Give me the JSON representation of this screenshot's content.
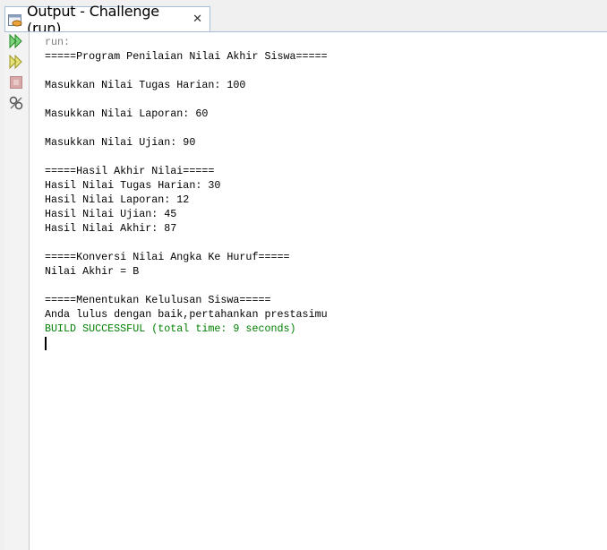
{
  "tab": {
    "title": "Output - Challenge (run)",
    "close": "✕",
    "icon": "output-window-icon"
  },
  "toolbar": [
    {
      "name": "rerun-icon",
      "color": "#2e9b2e"
    },
    {
      "name": "rerun-with-options-icon",
      "color": "#b5b52a"
    },
    {
      "name": "stop-icon",
      "color": "#c99"
    },
    {
      "name": "settings-icon",
      "color": "#777"
    }
  ],
  "output": {
    "lines": [
      {
        "text": "run:",
        "style": "gray"
      },
      {
        "text": "=====Program Penilaian Nilai Akhir Siswa=====",
        "style": ""
      },
      {
        "text": "",
        "style": ""
      },
      {
        "text": "Masukkan Nilai Tugas Harian: 100",
        "style": ""
      },
      {
        "text": "",
        "style": ""
      },
      {
        "text": "Masukkan Nilai Laporan: 60",
        "style": ""
      },
      {
        "text": "",
        "style": ""
      },
      {
        "text": "Masukkan Nilai Ujian: 90",
        "style": ""
      },
      {
        "text": "",
        "style": ""
      },
      {
        "text": "=====Hasil Akhir Nilai=====",
        "style": ""
      },
      {
        "text": "Hasil Nilai Tugas Harian: 30",
        "style": ""
      },
      {
        "text": "Hasil Nilai Laporan: 12",
        "style": ""
      },
      {
        "text": "Hasil Nilai Ujian: 45",
        "style": ""
      },
      {
        "text": "Hasil Nilai Akhir: 87",
        "style": ""
      },
      {
        "text": "",
        "style": ""
      },
      {
        "text": "=====Konversi Nilai Angka Ke Huruf=====",
        "style": ""
      },
      {
        "text": "Nilai Akhir = B",
        "style": ""
      },
      {
        "text": "",
        "style": ""
      },
      {
        "text": "=====Menentukan Kelulusan Siswa=====",
        "style": ""
      },
      {
        "text": "Anda lulus dengan baik,pertahankan prestasimu",
        "style": ""
      },
      {
        "text": "BUILD SUCCESSFUL (total time: 9 seconds)",
        "style": "green"
      }
    ]
  }
}
